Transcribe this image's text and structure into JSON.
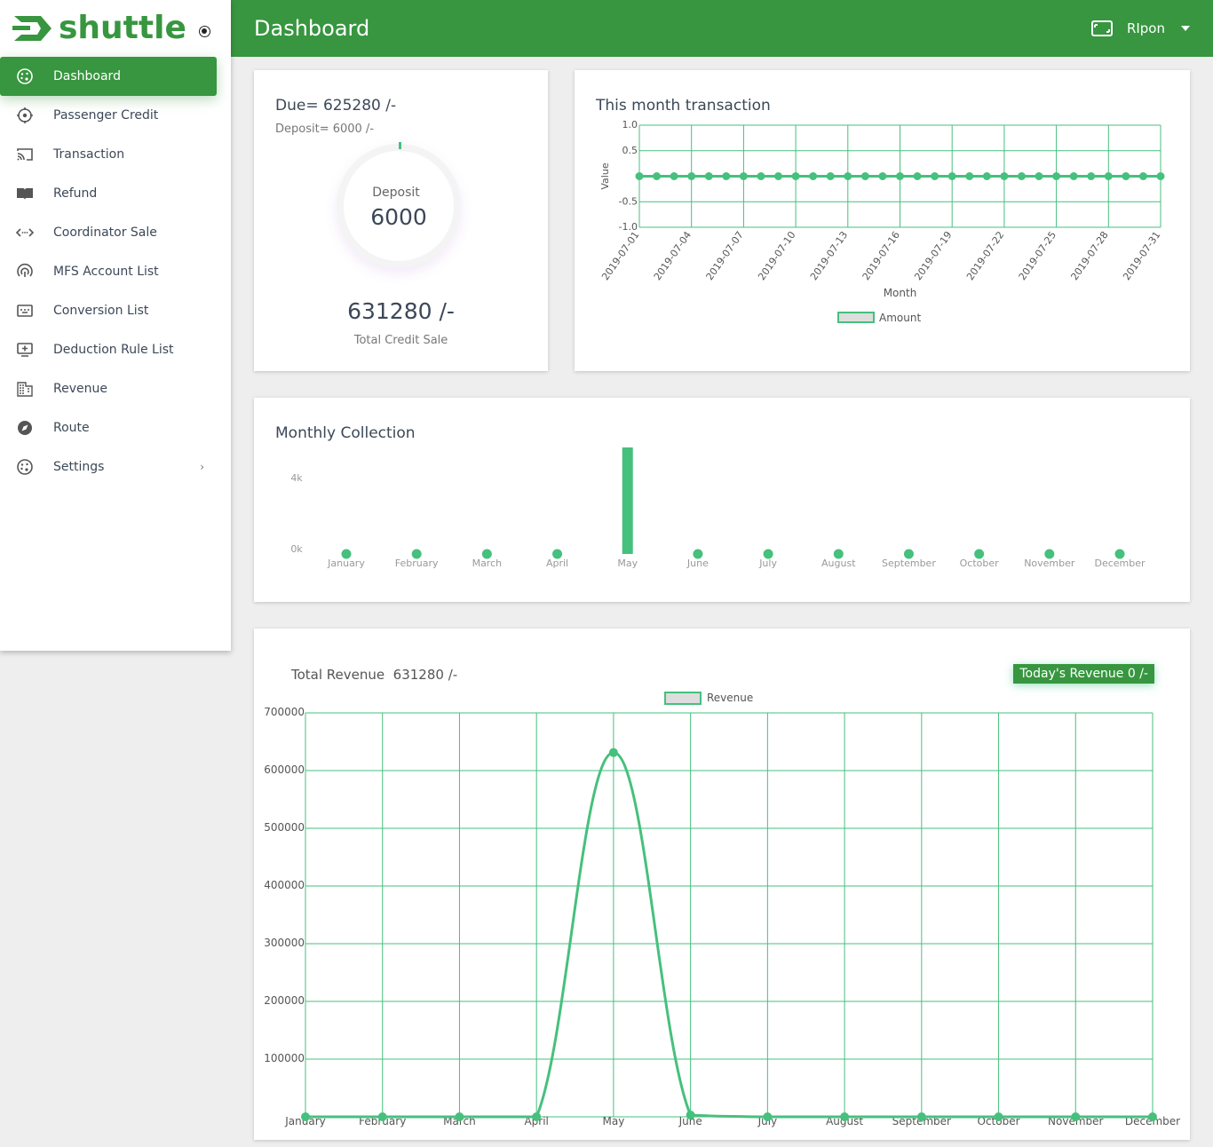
{
  "app": {
    "brand": "shuttle"
  },
  "header": {
    "title": "Dashboard",
    "user": "RIpon"
  },
  "sidebar": {
    "items": [
      {
        "label": "Dashboard",
        "icon": "palette-icon",
        "active": true
      },
      {
        "label": "Passenger Credit",
        "icon": "target-icon"
      },
      {
        "label": "Transaction",
        "icon": "cast-icon"
      },
      {
        "label": "Refund",
        "icon": "book-icon"
      },
      {
        "label": "Coordinator Sale",
        "icon": "code-arrows-icon"
      },
      {
        "label": "MFS Account List",
        "icon": "fingerprint-icon"
      },
      {
        "label": "Conversion List",
        "icon": "card-icon"
      },
      {
        "label": "Deduction Rule List",
        "icon": "add-to-queue-icon"
      },
      {
        "label": "Revenue",
        "icon": "building-icon"
      },
      {
        "label": "Route",
        "icon": "compass-icon"
      },
      {
        "label": "Settings",
        "icon": "palette-icon",
        "has_submenu": true
      }
    ]
  },
  "summary": {
    "due": "Due= 625280 /-",
    "deposit": "Deposit= 6000 /-",
    "ring_label": "Deposit",
    "ring_value": "6000",
    "total": "631280 /-",
    "total_label": "Total Credit Sale"
  },
  "transaction": {
    "title": "This month transaction"
  },
  "collection": {
    "title": "Monthly Collection"
  },
  "revenue": {
    "total_label": "Total Revenue",
    "total_value": "631280 /-",
    "today": "Today's Revenue 0 /-"
  },
  "colors": {
    "brand": "#37963f",
    "chart": "#46c07d"
  },
  "chart_data": [
    {
      "type": "line",
      "xlabel": "Month",
      "ylabel": "Value",
      "x": [
        "2019-07-01",
        "2019-07-02",
        "2019-07-03",
        "2019-07-04",
        "2019-07-05",
        "2019-07-06",
        "2019-07-07",
        "2019-07-08",
        "2019-07-09",
        "2019-07-10",
        "2019-07-11",
        "2019-07-12",
        "2019-07-13",
        "2019-07-14",
        "2019-07-15",
        "2019-07-16",
        "2019-07-17",
        "2019-07-18",
        "2019-07-19",
        "2019-07-20",
        "2019-07-21",
        "2019-07-22",
        "2019-07-23",
        "2019-07-24",
        "2019-07-25",
        "2019-07-26",
        "2019-07-27",
        "2019-07-28",
        "2019-07-29",
        "2019-07-30",
        "2019-07-31"
      ],
      "tick_labels": [
        "2019-07-01",
        "2019-07-04",
        "2019-07-07",
        "2019-07-10",
        "2019-07-13",
        "2019-07-16",
        "2019-07-19",
        "2019-07-22",
        "2019-07-25",
        "2019-07-28",
        "2019-07-31"
      ],
      "yticks": [
        "1.0",
        "0.5",
        "0",
        "-0.5",
        "-1.0"
      ],
      "ylim": [
        -1,
        1
      ],
      "grid": true,
      "legend": "bottom",
      "series": [
        {
          "name": "Amount",
          "values": [
            0,
            0,
            0,
            0,
            0,
            0,
            0,
            0,
            0,
            0,
            0,
            0,
            0,
            0,
            0,
            0,
            0,
            0,
            0,
            0,
            0,
            0,
            0,
            0,
            0,
            0,
            0,
            0,
            0,
            0,
            0
          ]
        }
      ]
    },
    {
      "type": "bar",
      "categories": [
        "January",
        "February",
        "March",
        "April",
        "May",
        "June",
        "July",
        "August",
        "September",
        "October",
        "November",
        "December"
      ],
      "values": [
        0,
        0,
        0,
        0,
        631280,
        0,
        0,
        0,
        0,
        0,
        0,
        0
      ],
      "yticks": [
        "4k",
        "0k"
      ],
      "grid": false
    },
    {
      "type": "line",
      "categories": [
        "January",
        "February",
        "March",
        "April",
        "May",
        "June",
        "July",
        "August",
        "September",
        "October",
        "November",
        "December"
      ],
      "yticks": [
        "700000",
        "600000",
        "500000",
        "400000",
        "300000",
        "200000",
        "100000"
      ],
      "ylim": [
        0,
        700000
      ],
      "grid": true,
      "legend": "top",
      "series": [
        {
          "name": "Revenue",
          "values": [
            0,
            0,
            0,
            0,
            631280,
            3000,
            0,
            0,
            0,
            0,
            0,
            0
          ]
        }
      ]
    }
  ]
}
